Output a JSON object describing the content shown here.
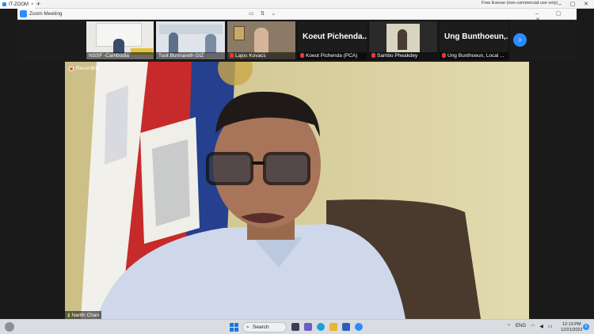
{
  "browser": {
    "tab_title": "IT-ZOOM",
    "tab_close": "×",
    "new_tab": "+",
    "license": "Free license (non-commercial use only)",
    "minimize": "–",
    "maximize": "▢",
    "close": "✕"
  },
  "zoom_window": {
    "title": "Zoom Meeting",
    "controls": "▭ ⇅ ⌄"
  },
  "gallery": {
    "tiles": [
      {
        "name": "NSSF -Cambodia"
      },
      {
        "name": "Tuot Bunnareth GIZ"
      },
      {
        "name": "Lajos Kovacs"
      },
      {
        "name": "Koeut Pichenda (PCA)",
        "big_name": "Koeut Pichenda..."
      },
      {
        "name": "Sambo Pheakdey"
      },
      {
        "name": "Ung Bunthoeun, Local ...",
        "big_name": "Ung Bunthoeun,..."
      }
    ],
    "next_icon": "›"
  },
  "main_video": {
    "recording_label": "Recording",
    "speaker_name": "Narith Chan"
  },
  "taskbar": {
    "search_label": "Search",
    "language": "ENG",
    "time": "12:13 PM",
    "date": "12/21/2022",
    "notifications": "5"
  },
  "colors": {
    "zoom_blue": "#2d8cff",
    "mic_muted": "#e03b3b",
    "recording": "#e34c4c"
  }
}
